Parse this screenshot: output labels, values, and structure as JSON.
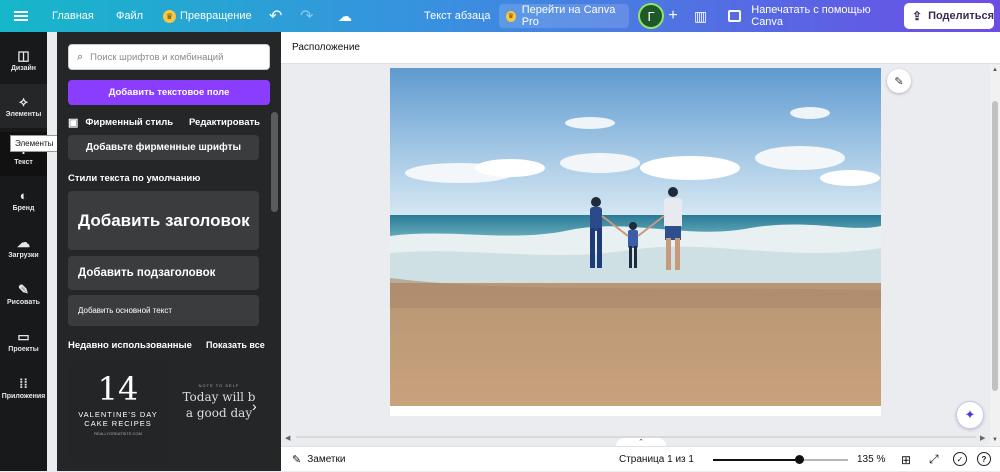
{
  "topbar": {
    "home": "Главная",
    "file": "Файл",
    "resize": "Превращение",
    "doc_title": "Текст абзаца",
    "canva_pro": "Перейти на Canva Pro",
    "avatar_letter": "Г",
    "print": "Напечатать с помощью Canva",
    "share": "Поделиться"
  },
  "rail": {
    "items": [
      {
        "label": "Дизайн",
        "icon": "layout-icon"
      },
      {
        "label": "Элементы",
        "icon": "shapes-icon"
      },
      {
        "label": "Текст",
        "icon": "text-icon"
      },
      {
        "label": "Бренд",
        "icon": "brand-icon"
      },
      {
        "label": "Загрузки",
        "icon": "upload-cloud-icon"
      },
      {
        "label": "Рисовать",
        "icon": "pen-icon"
      },
      {
        "label": "Проекты",
        "icon": "folder-icon"
      },
      {
        "label": "Приложения",
        "icon": "apps-grid-icon"
      }
    ],
    "tooltip": "Элементы"
  },
  "panel": {
    "search_placeholder": "Поиск шрифтов и комбинаций",
    "add_text_button": "Добавить текстовое поле",
    "brand_style": "Фирменный стиль",
    "edit": "Редактировать",
    "add_brand_fonts": "Добавьте фирменные шрифты",
    "default_styles_title": "Стили текста по умолчанию",
    "add_heading": "Добавить заголовок",
    "add_subheading": "Добавить подзаголовок",
    "add_body": "Добавить основной текст",
    "recent_title": "Недавно использованные",
    "show_all": "Показать все",
    "template1": {
      "number": "14",
      "line1": "VALENTINE'S DAY",
      "line2": "CAKE RECIPES",
      "line3": "REALLYGREATSITE.COM"
    },
    "template2": {
      "tiny": "NOTE TO SELF",
      "line1": "Today will b",
      "line2": "a good day"
    }
  },
  "canvas": {
    "context_label": "Расположение"
  },
  "bottombar": {
    "notes": "Заметки",
    "page_indicator": "Страница 1 из 1",
    "zoom": "135 %",
    "zoom_fraction": 0.64
  },
  "colors": {
    "accent_purple": "#8b3dff",
    "panel_bg": "#252627",
    "rail_bg": "#18191b"
  }
}
